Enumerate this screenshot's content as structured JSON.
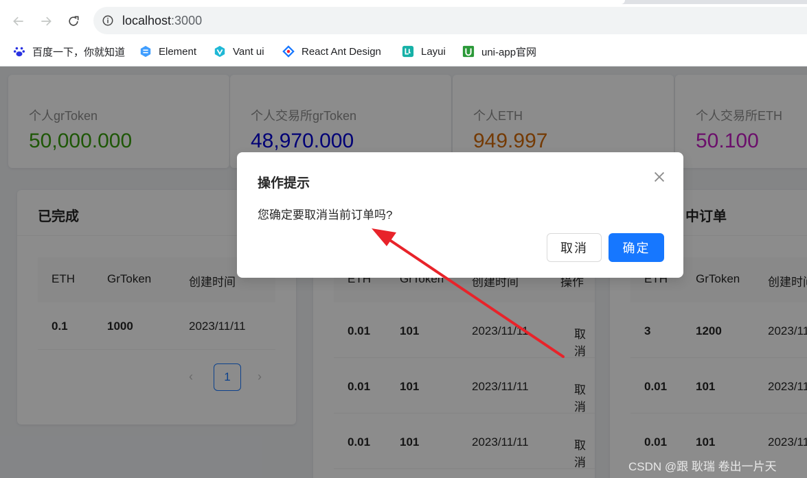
{
  "browser": {
    "url_host": "localhost",
    "url_port": ":3000",
    "bookmarks": [
      {
        "label": "百度一下，你就知道",
        "icon": "baidu-paw-icon"
      },
      {
        "label": "Element",
        "icon": "element-logo-icon"
      },
      {
        "label": "Vant ui",
        "icon": "vant-logo-icon"
      },
      {
        "label": "React Ant Design",
        "icon": "antd-logo-icon"
      },
      {
        "label": "Layui",
        "icon": "layui-logo-icon"
      },
      {
        "label": "uni-app官网",
        "icon": "uniapp-logo-icon"
      }
    ]
  },
  "stats": [
    {
      "label": "个人grToken",
      "value": "50,000.000",
      "color": "#389e0d"
    },
    {
      "label": "个人交易所grToken",
      "value": "48,970.000",
      "color": "#0000d6"
    },
    {
      "label": "个人ETH",
      "value": "949.997",
      "color": "#d46b08"
    },
    {
      "label": "个人交易所ETH",
      "value": "50.100",
      "color": "#c41dc4"
    }
  ],
  "completed": {
    "title": "已完成",
    "columns": [
      "ETH",
      "GrToken",
      "创建时间"
    ],
    "rows": [
      {
        "eth": "0.1",
        "grtoken": "1000",
        "time": "2023/11/11"
      }
    ],
    "page": "1"
  },
  "middle": {
    "columns": [
      "ETH",
      "GrToken",
      "创建时间",
      "操作"
    ],
    "rows": [
      {
        "eth": "0.01",
        "grtoken": "101",
        "time": "2023/11/11",
        "action": "取消"
      },
      {
        "eth": "0.01",
        "grtoken": "101",
        "time": "2023/11/11",
        "action": "取消"
      },
      {
        "eth": "0.01",
        "grtoken": "101",
        "time": "2023/11/11",
        "action": "取消"
      }
    ]
  },
  "right": {
    "title_fragment": "中订单",
    "columns": [
      "ETH",
      "GrToken",
      "创建时间"
    ],
    "rows": [
      {
        "eth": "3",
        "grtoken": "1200",
        "time": "2023/11"
      },
      {
        "eth": "0.01",
        "grtoken": "101",
        "time": "2023/11"
      },
      {
        "eth": "0.01",
        "grtoken": "101",
        "time": "2023/11"
      }
    ]
  },
  "modal": {
    "title": "操作提示",
    "content": "您确定要取消当前订单吗?",
    "cancel_label": "取消",
    "ok_label": "确定",
    "primary_color": "#1677ff"
  },
  "watermark": "CSDN @跟 耿瑞 卷出一片天"
}
